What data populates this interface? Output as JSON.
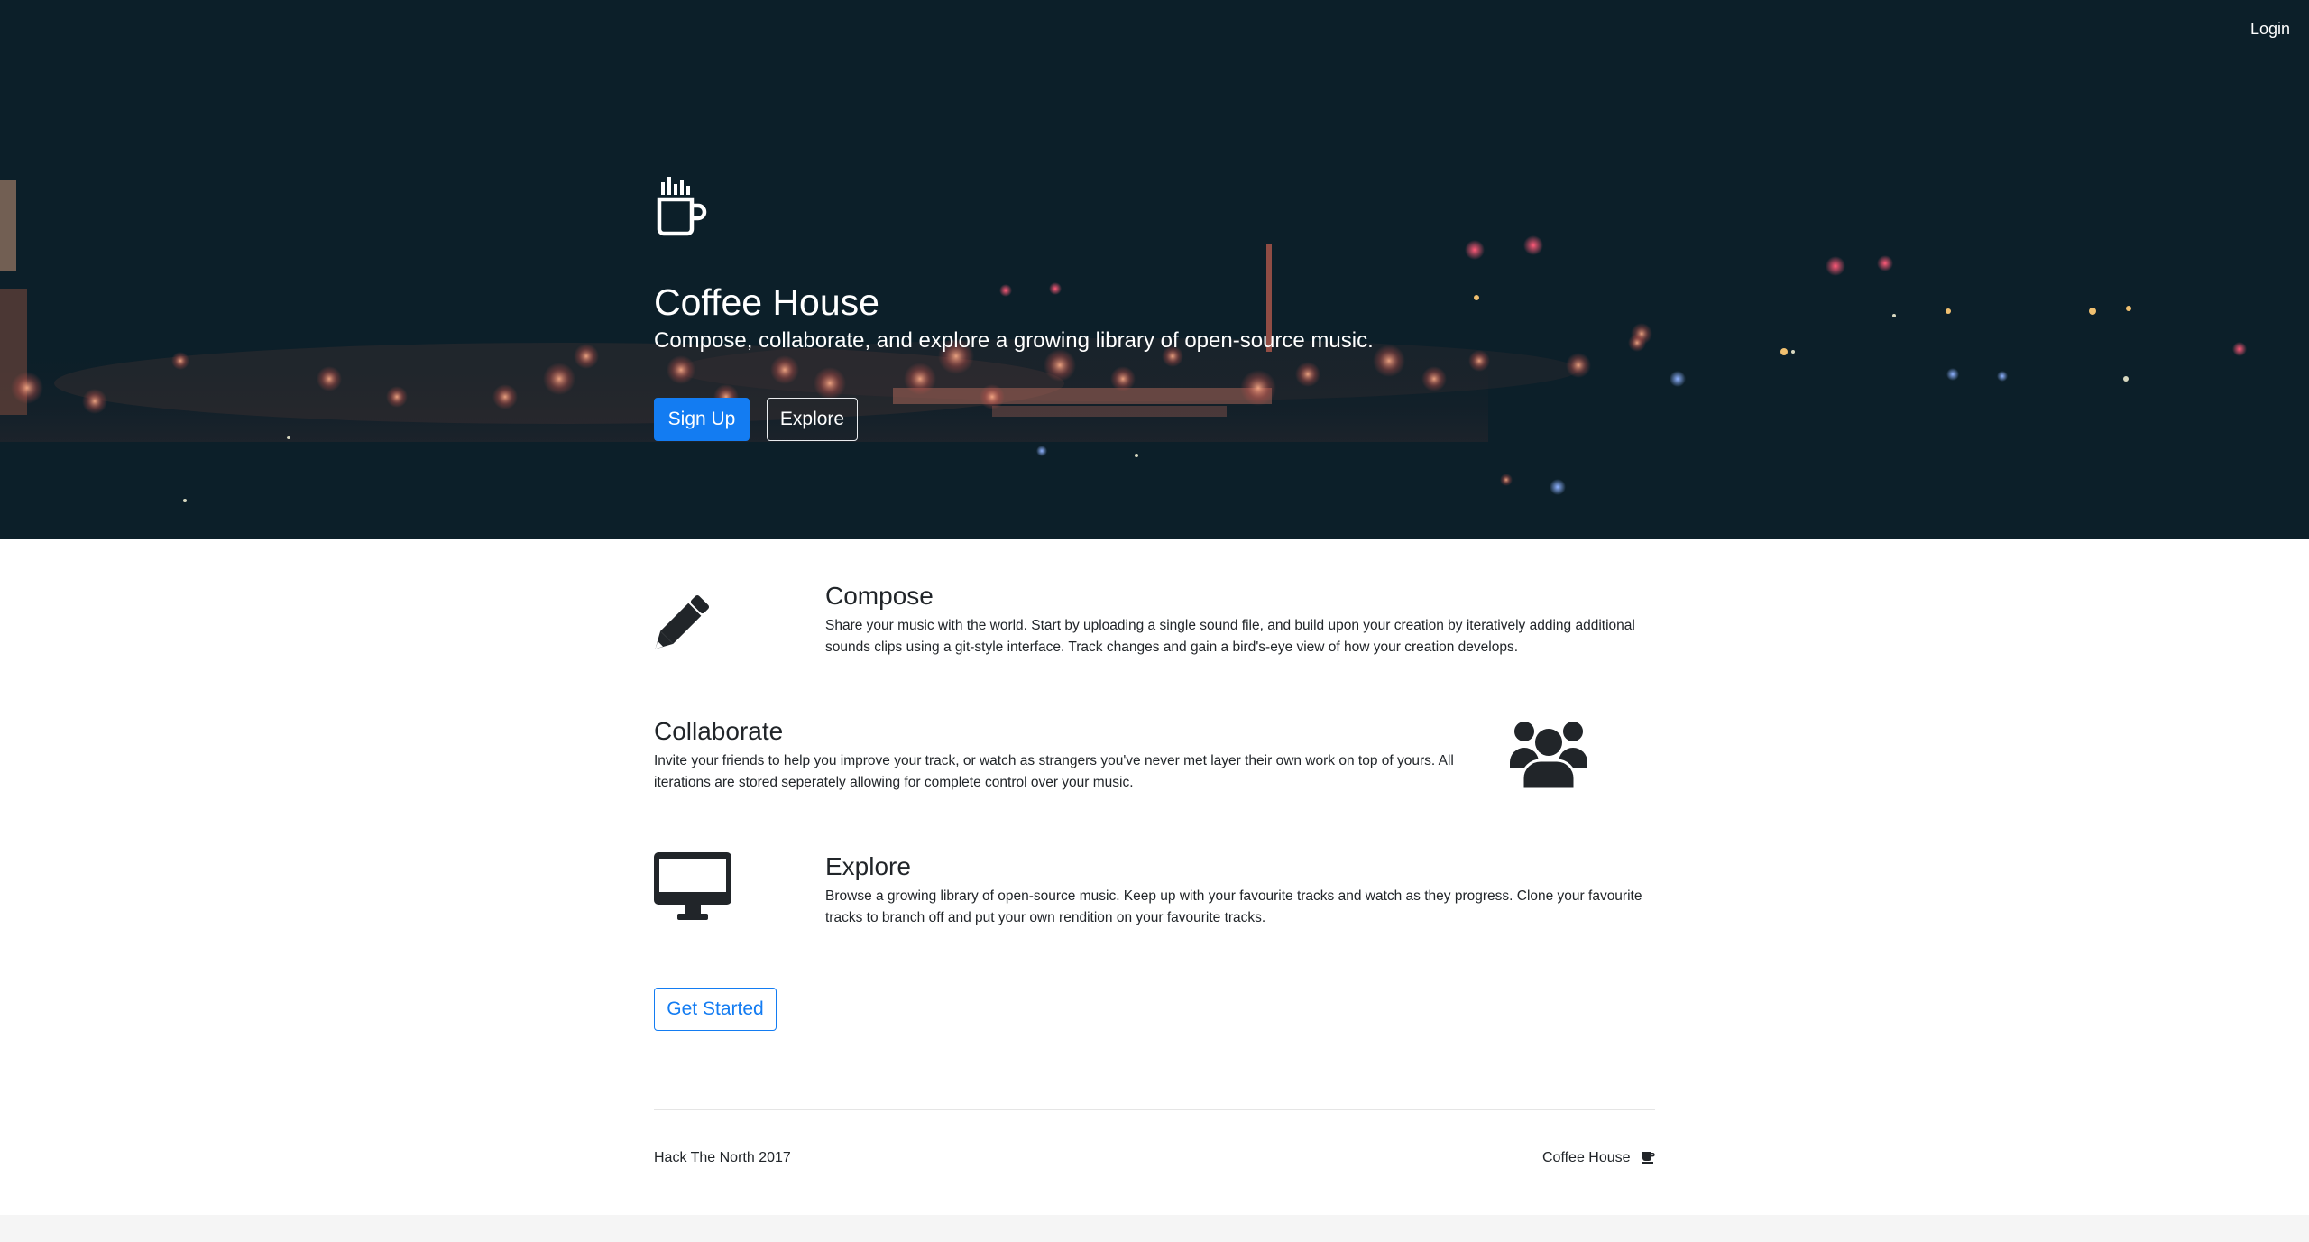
{
  "header": {
    "login_label": "Login"
  },
  "hero": {
    "title": "Coffee House",
    "subtitle": "Compose, collaborate, and explore a growing library of open-source music.",
    "signup_label": "Sign Up",
    "explore_label": "Explore",
    "logo_icon": "coffee-music-icon"
  },
  "features": [
    {
      "title": "Compose",
      "text": "Share your music with the world. Start by uploading a single sound file, and build upon your creation by iteratively adding additional sounds clips using a git-style interface. Track changes and gain a bird's-eye view of how your creation develops.",
      "icon": "pencil-icon"
    },
    {
      "title": "Collaborate",
      "text": "Invite your friends to help you improve your track, or watch as strangers you've never met layer their own work on top of yours. All iterations are stored seperately allowing for complete control over your music.",
      "icon": "users-icon"
    },
    {
      "title": "Explore",
      "text": "Browse a growing library of open-source music. Keep up with your favourite tracks and watch as they progress. Clone your favourite tracks to branch off and put your own rendition on your favourite tracks.",
      "icon": "desktop-icon"
    }
  ],
  "cta": {
    "get_started_label": "Get Started"
  },
  "footer": {
    "left_text": "Hack The North 2017",
    "right_text": "Coffee House",
    "right_icon": "coffee-icon"
  },
  "colors": {
    "primary": "#137cf2",
    "hero_bg": "#0c1f29",
    "text": "#212529"
  }
}
